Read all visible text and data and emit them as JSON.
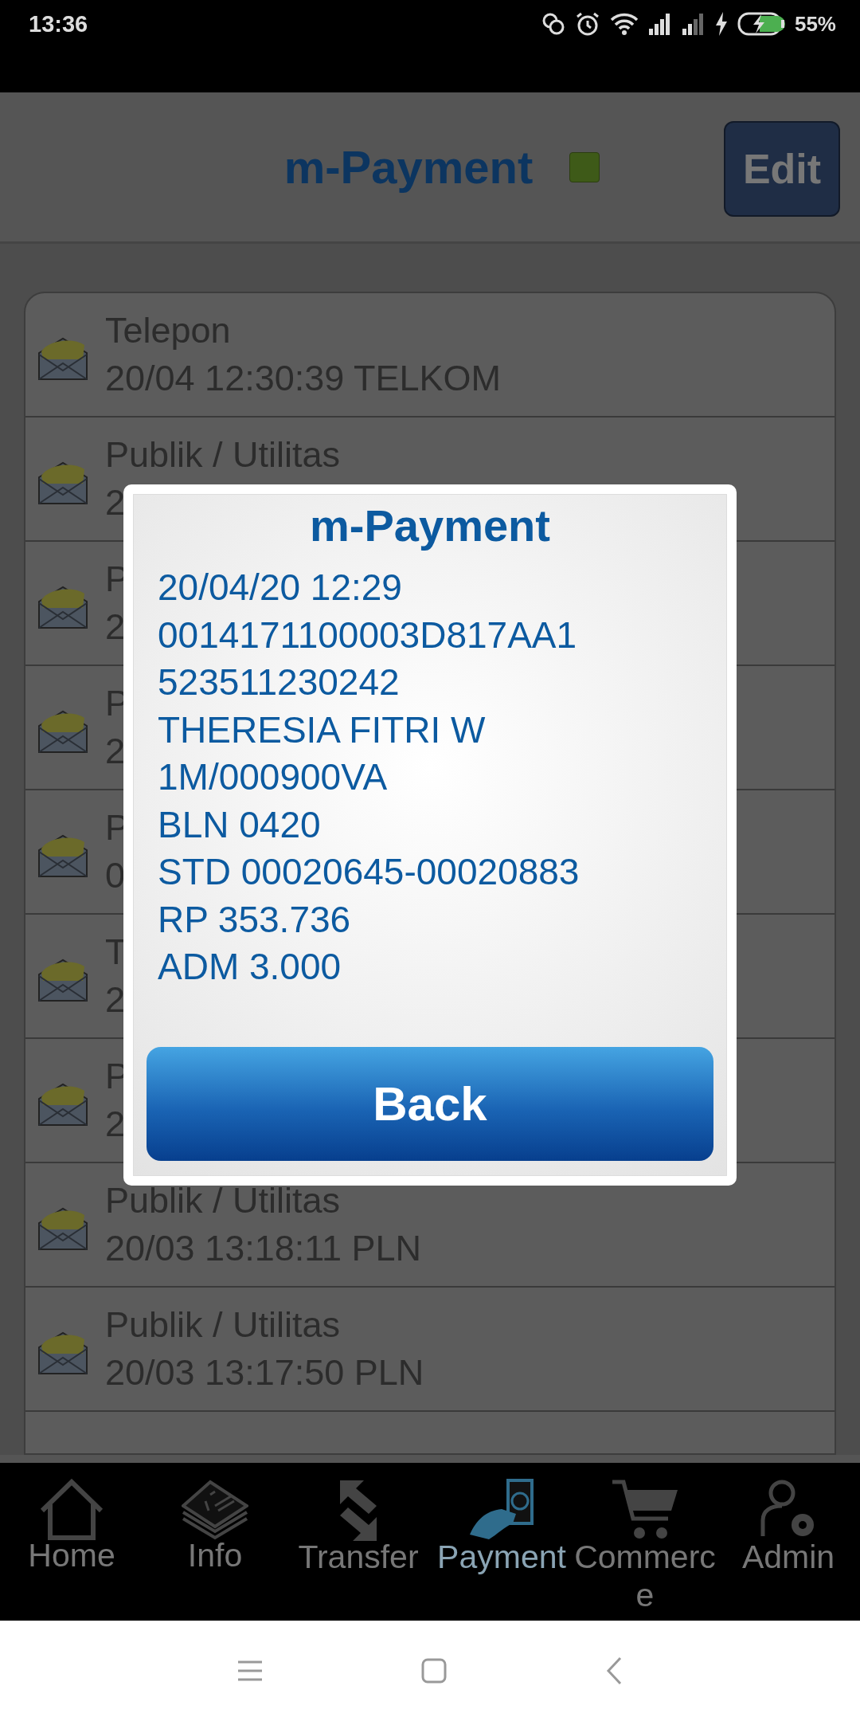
{
  "status_bar": {
    "time": "13:36",
    "battery": "55%"
  },
  "header": {
    "title": "m-Payment",
    "edit_button": "Edit"
  },
  "messages": [
    {
      "title": "Telepon",
      "detail": "20/04 12:30:39 TELKOM"
    },
    {
      "title": "Publik / Utilitas",
      "detail": "2"
    },
    {
      "title": "P",
      "detail": "2"
    },
    {
      "title": "P",
      "detail": "2"
    },
    {
      "title": "P",
      "detail": "0"
    },
    {
      "title": "T",
      "detail": "2"
    },
    {
      "title": "P",
      "detail": "2"
    },
    {
      "title": "Publik / Utilitas",
      "detail": "20/03 13:18:11 PLN"
    },
    {
      "title": "Publik / Utilitas",
      "detail": "20/03 13:17:50 PLN"
    }
  ],
  "dialog": {
    "title": "m-Payment",
    "lines": [
      "20/04/20 12:29",
      "0014171100003D817AA1",
      "523511230242",
      "THERESIA FITRI W",
      "1M/000900VA",
      "BLN 0420",
      "STD 00020645-00020883",
      "RP 353.736",
      "ADM 3.000"
    ],
    "button": "Back"
  },
  "bottom_nav": [
    {
      "label": "Home",
      "kind": "home",
      "selected": false
    },
    {
      "label": "Info",
      "kind": "info",
      "selected": false
    },
    {
      "label": "Transfer",
      "kind": "transfer",
      "selected": false
    },
    {
      "label": "Payment",
      "kind": "payment",
      "selected": true
    },
    {
      "label": "Commerce",
      "kind": "cart",
      "selected": false
    },
    {
      "label": "Admin",
      "kind": "admin",
      "selected": false
    }
  ]
}
